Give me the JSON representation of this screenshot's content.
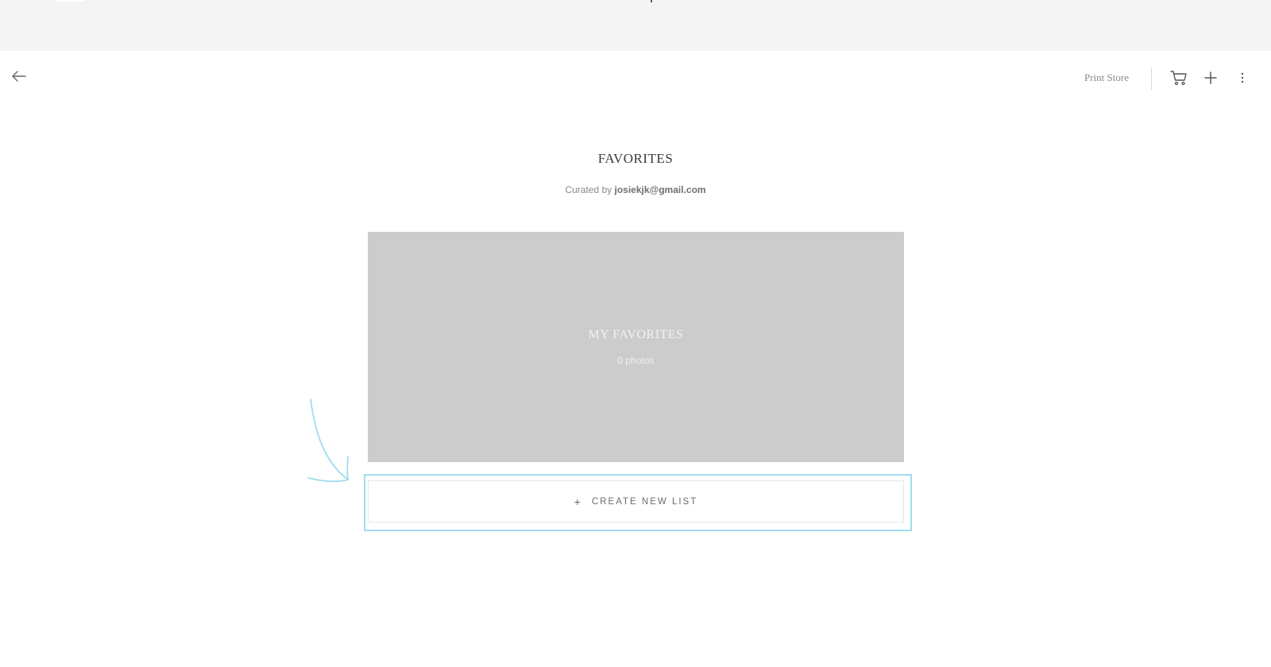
{
  "header": {
    "print_store_label": "Print Store",
    "back_icon": "arrow-left-icon",
    "cart_icon": "cart-icon",
    "add_icon": "plus-icon",
    "more_icon": "more-vertical-icon"
  },
  "page": {
    "title": "FAVORITES",
    "curated_prefix": "Curated by",
    "curator_email": "josiekjk@gmail.com"
  },
  "favorites_list": {
    "name": "MY FAVORITES",
    "count_label": "0 photos"
  },
  "actions": {
    "create_list_icon": "+",
    "create_list_label": "CREATE NEW LIST"
  },
  "colors": {
    "card_background": "#cccccc",
    "highlight_annotation": "#9fdcef",
    "top_band": "#f4f4f4"
  }
}
